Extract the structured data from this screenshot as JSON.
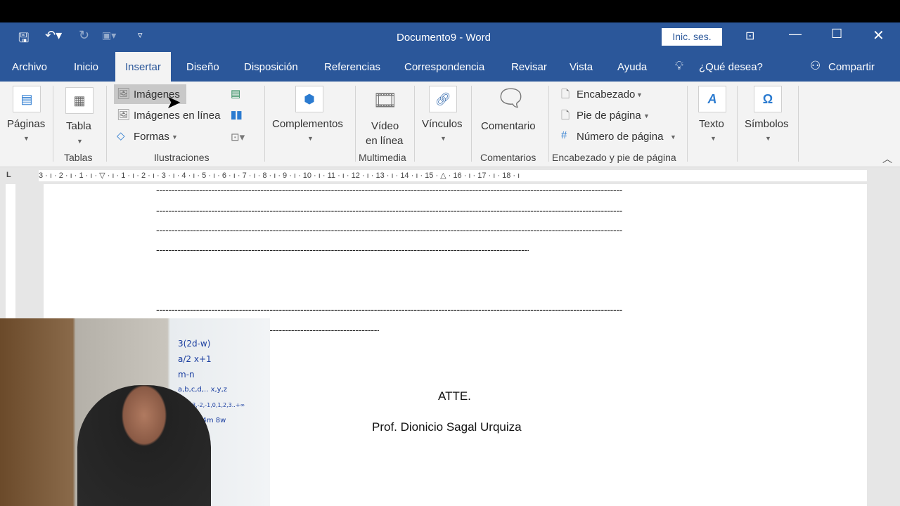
{
  "window": {
    "title": "Documento9 - Word",
    "signin": "Inic. ses."
  },
  "qat": {
    "icons": [
      "save-icon",
      "undo-icon",
      "redo-icon",
      "format-icon",
      "customize-icon"
    ]
  },
  "tabs": [
    "Archivo",
    "Inicio",
    "Insertar",
    "Diseño",
    "Disposición",
    "Referencias",
    "Correspondencia",
    "Revisar",
    "Vista",
    "Ayuda"
  ],
  "active_tab": "Insertar",
  "tellme": "¿Qué desea?",
  "share": "Compartir",
  "ribbon": {
    "paginas": "Páginas",
    "tabla": "Tabla",
    "tablas_group": "Tablas",
    "imagenes": "Imágenes",
    "imagenes_linea": "Imágenes en línea",
    "formas": "Formas",
    "ilustraciones_group": "Ilustraciones",
    "complementos": "Complementos",
    "video1": "Vídeo",
    "video2": "en línea",
    "multimedia_group": "Multimedia",
    "vinculos": "Vínculos",
    "comentario": "Comentario",
    "comentarios_group": "Comentarios",
    "encabezado": "Encabezado",
    "pie": "Pie de página",
    "numero": "Número de página",
    "encabezado_group": "Encabezado y pie de página",
    "texto": "Texto",
    "simbolos": "Símbolos"
  },
  "ruler": "3 · ı · 2 · ı · 1 · ı · ▽ · ı · 1 · ı · 2 · ı · 3 · ı · 4 · ı · 5 · ı · 6 · ı · 7 · ı · 8 · ı · 9 · ı · 10 · ı · 11 · ı · 12 · ı · 13 · ı · 14 · ı · 15 · △ · 16 · ı · 17 · ı · 18 · ı",
  "document": {
    "dash_line": "--------------------------------------------------------------------------------------------------------------------------------------------------------",
    "atte": "ATTE.",
    "signature": "Prof. Dionicio Sagal Urquiza"
  },
  "webcam": {
    "board_lines": [
      "3(2d-w)",
      "a/2   x+1",
      "      m-n",
      "a,b,c,d,.. x,y,z",
      "-∞,..-3,-2,-1,0,1,2,3..+∞",
      "-3y   2x   4m   8w"
    ]
  },
  "colors": {
    "accent": "#2b579a",
    "ribbon": "#f3f3f3"
  }
}
